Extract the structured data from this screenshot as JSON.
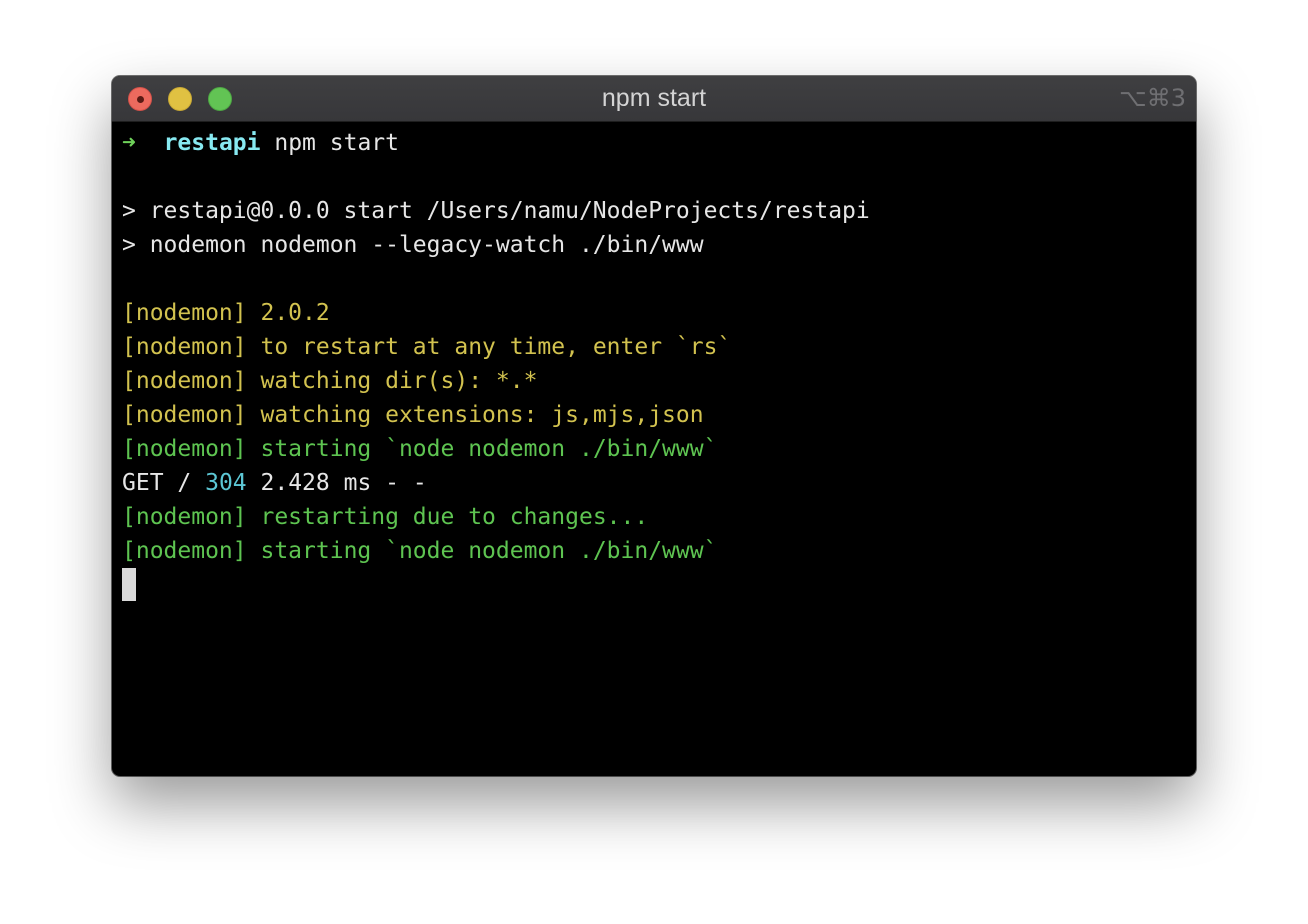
{
  "window": {
    "title": "npm start",
    "shortcut": "⌥⌘3"
  },
  "terminal": {
    "prompt": {
      "arrow": "➜",
      "directory": "restapi",
      "command": "npm start"
    },
    "npm_header": [
      "> restapi@0.0.0 start /Users/namu/NodeProjects/restapi",
      "> nodemon nodemon --legacy-watch ./bin/www"
    ],
    "nodemon_tag": "[nodemon]",
    "nodemon_info": [
      "2.0.2",
      "to restart at any time, enter `rs`",
      "watching dir(s): *.*",
      "watching extensions: js,mjs,json"
    ],
    "nodemon_start_1": "starting `node nodemon ./bin/www`",
    "request_log": {
      "method_path": "GET /",
      "status": "304",
      "rest": "2.428 ms - -"
    },
    "nodemon_restart": "restarting due to changes...",
    "nodemon_start_2": "starting `node nodemon ./bin/www`"
  },
  "colors": {
    "background": "#000000",
    "prompt_arrow": "#6fd25a",
    "prompt_dir": "#87e9f1",
    "nodemon_yellow": "#d2c24f",
    "nodemon_green": "#5ec451",
    "status_cyan": "#5cc6d4"
  }
}
